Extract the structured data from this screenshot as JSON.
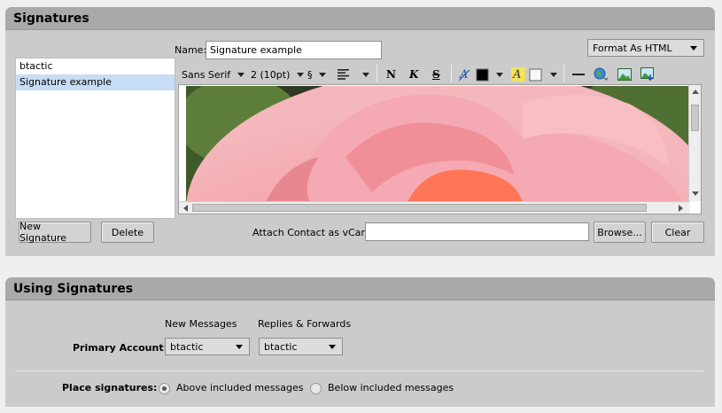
{
  "signatures_panel": {
    "title": "Signatures",
    "list": [
      {
        "label": "btactic",
        "selected": false
      },
      {
        "label": "Signature example",
        "selected": true
      }
    ],
    "name_label": "Name:",
    "name_value": "Signature example",
    "format_select": "Format As HTML",
    "toolbar": {
      "font_family": "Sans Serif",
      "font_size": "2 (10pt)",
      "paragraph_symbol": "§",
      "bold_glyph": "N",
      "italic_glyph": "K",
      "strike_glyph": "S"
    },
    "new_button": "New Signature",
    "delete_button": "Delete",
    "vcard_label": "Attach Contact as vCard:",
    "vcard_value": "",
    "browse_button": "Browse...",
    "clear_button": "Clear"
  },
  "using_panel": {
    "title": "Using Signatures",
    "col_new": "New Messages",
    "col_replies": "Replies & Forwards",
    "primary_label": "Primary Account:",
    "new_value": "btactic",
    "replies_value": "btactic",
    "place_label": "Place signatures:",
    "above_label": "Above included messages",
    "below_label": "Below included messages",
    "placement_selected": "above"
  },
  "colors": {
    "panel_bg": "#cbcbcb",
    "header_bg": "#a9a9a9",
    "selection": "#c7dcf5"
  }
}
